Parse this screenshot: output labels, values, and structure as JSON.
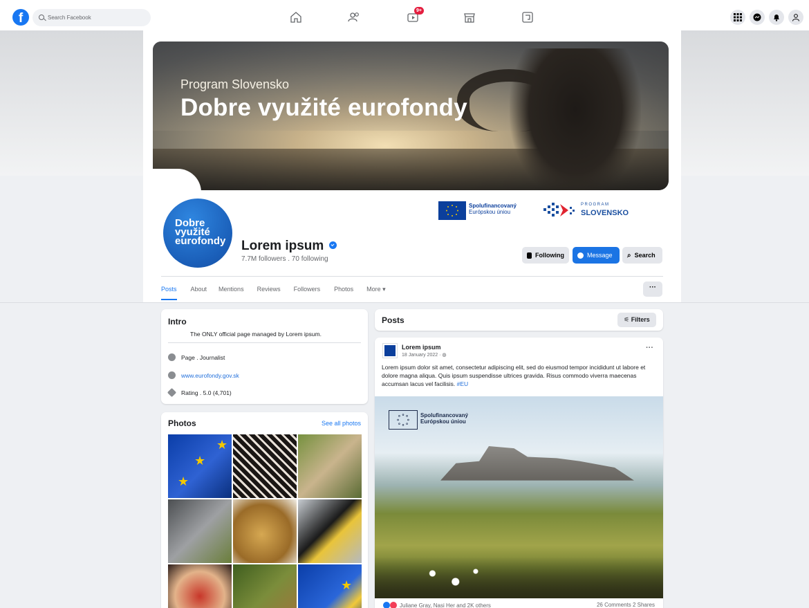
{
  "topbar": {
    "logo": "f",
    "search_placeholder": "Search Facebook",
    "watch_badge": "9+"
  },
  "cover": {
    "subtitle": "Program Slovensko",
    "title": "Dobre využité eurofondy"
  },
  "profile": {
    "avatar_lines": [
      "Dobre",
      "využité",
      "eurofondy"
    ],
    "name": "Lorem ipsum",
    "stats": "7.7M followers . 70 following",
    "eu_text_1": "Spolufinancovaný",
    "eu_text_2": "Európskou úniou",
    "ps_small": "PROGRAM",
    "ps_big": "SLOVENSKO"
  },
  "buttons": {
    "following": "Following",
    "message": "Message",
    "search": "Search"
  },
  "tabs": [
    "Posts",
    "About",
    "Mentions",
    "Reviews",
    "Followers",
    "Photos",
    "More ▾"
  ],
  "tab_more_button": "···",
  "intro": {
    "title": "Intro",
    "description": "The ONLY official page managed by Lorem ipsum.",
    "category": "Page . Journalist",
    "website": "www.eurofondy.gov.sk",
    "rating": "Rating . 5.0 (4,701)"
  },
  "photos": {
    "title": "Photos",
    "see_all": "See all photos"
  },
  "posts_header": {
    "title": "Posts",
    "filters": "Filters"
  },
  "post": {
    "author": "Lorem ipsum",
    "date": "18 January 2022 · ",
    "text": "Lorem ipsum dolor sit amet, consectetur adipiscing elit, sed do eiusmod tempor incididunt ut labore et dolore magna aliqua. Quis ipsum suspendisse ultrices gravida. Risus commodo viverra maecenas accumsan lacus vel facilisis. ",
    "hashtag": "#EU",
    "image_eu_1": "Spolufinancovaný",
    "image_eu_2": "Európskou úniou",
    "reactions": "Juliane Gray, Nasi Her and 2K others",
    "engagement": "26 Comments  2 Shares"
  },
  "colors": {
    "brand": "#1877f2",
    "message_button": "#1b74e4",
    "badge": "#e41e3f"
  },
  "icons": [
    "facebook-logo",
    "search-icon",
    "home-icon",
    "friends-icon",
    "watch-icon",
    "marketplace-icon",
    "gaming-icon",
    "menu-grid-icon",
    "messenger-icon",
    "notifications-icon",
    "account-icon"
  ]
}
